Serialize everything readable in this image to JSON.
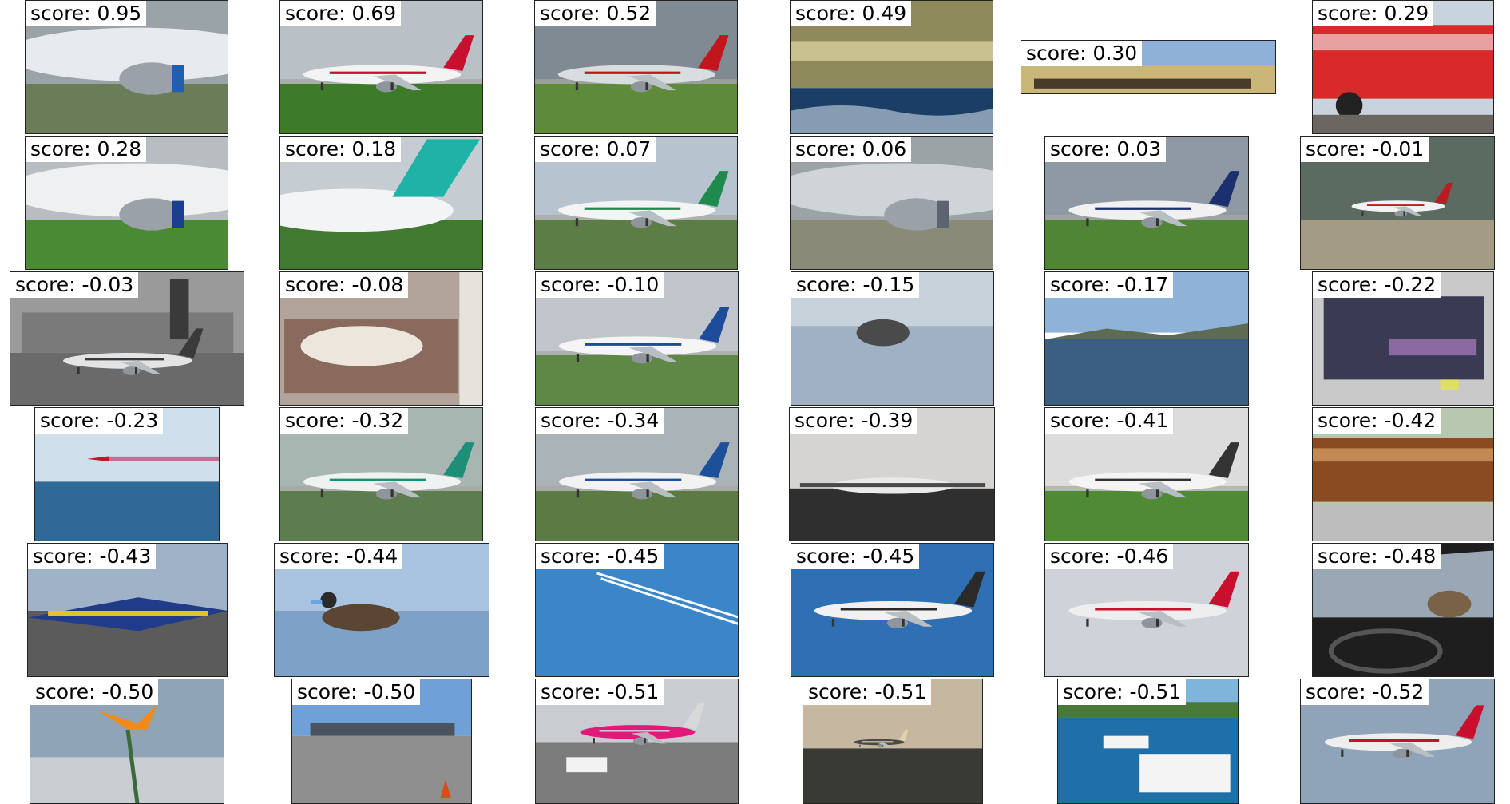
{
  "figure": {
    "tiles": [
      {
        "score": "score: 0.95",
        "scene": "airliner-closeup",
        "colors": {
          "sky": "#9aa3a8",
          "ground": "#6a7d58",
          "body": "#e8ebee",
          "accent": "#1f5fb0"
        }
      },
      {
        "score": "score: 0.69",
        "scene": "airliner",
        "colors": {
          "sky": "#b9c0c6",
          "ground": "#3d7a2a",
          "body": "#f3f3f3",
          "accent": "#c8102e"
        }
      },
      {
        "score": "score: 0.52",
        "scene": "airliner",
        "colors": {
          "sky": "#7f8a93",
          "ground": "#5e8b3a",
          "body": "#d9dde0",
          "accent": "#c0161c"
        }
      },
      {
        "score": "score: 0.49",
        "scene": "seascape",
        "colors": {
          "sky": "#8e8a5c",
          "ground": "#1b3e66",
          "body": "#d8c98a",
          "accent": "#f0e6b0"
        }
      },
      {
        "score": "score: 0.30",
        "scene": "train-landscape",
        "colors": {
          "sky": "#8fb1d8",
          "ground": "#9b8a55",
          "body": "#4a3a2a",
          "accent": "#c9b77a"
        }
      },
      {
        "score": "score: 0.29",
        "scene": "bus",
        "colors": {
          "sky": "#c9d3de",
          "ground": "#6b6660",
          "body": "#d82a2a",
          "accent": "#f2f2f2"
        }
      },
      {
        "score": "score: 0.28",
        "scene": "airliner-closeup",
        "colors": {
          "sky": "#b8bdc1",
          "ground": "#4a8a33",
          "body": "#eef0f2",
          "accent": "#1b3f8f"
        }
      },
      {
        "score": "score: 0.18",
        "scene": "airliner-tail",
        "colors": {
          "sky": "#c6cdd2",
          "ground": "#3f7a2e",
          "body": "#f2f4f5",
          "accent": "#1fb2a6"
        }
      },
      {
        "score": "score: 0.07",
        "scene": "airliner",
        "colors": {
          "sky": "#b7c4cf",
          "ground": "#5d7d47",
          "body": "#f4f4f4",
          "accent": "#1e8a4d"
        }
      },
      {
        "score": "score: 0.06",
        "scene": "airliner-closeup",
        "colors": {
          "sky": "#9ba3a6",
          "ground": "#8a8a78",
          "body": "#cfd4d8",
          "accent": "#5b6470"
        }
      },
      {
        "score": "score: 0.03",
        "scene": "airliner",
        "colors": {
          "sky": "#8e99a3",
          "ground": "#4f8534",
          "body": "#f1f1f1",
          "accent": "#1c2f6e"
        }
      },
      {
        "score": "score: -0.01",
        "scene": "jet-small",
        "colors": {
          "sky": "#5b6b61",
          "ground": "#a49b85",
          "body": "#f2f2f2",
          "accent": "#b81d24"
        }
      },
      {
        "score": "score: -0.03",
        "scene": "old-airport",
        "colors": {
          "sky": "#9a9a9a",
          "ground": "#6a6a6a",
          "body": "#e4e4e4",
          "accent": "#3a3a3a"
        }
      },
      {
        "score": "score: -0.08",
        "scene": "animals-bed",
        "colors": {
          "sky": "#b2a49a",
          "ground": "#8a6a5c",
          "body": "#ece6dc",
          "accent": "#6a4a3a"
        }
      },
      {
        "score": "score: -0.10",
        "scene": "airliner",
        "colors": {
          "sky": "#c0c6cb",
          "ground": "#5f8745",
          "body": "#f5f5f5",
          "accent": "#1e4b9a"
        }
      },
      {
        "score": "score: -0.15",
        "scene": "water-bird",
        "colors": {
          "sky": "#c8d2db",
          "ground": "#9fb1c2",
          "body": "#4a4a4a",
          "accent": "#7d8a95"
        }
      },
      {
        "score": "score: -0.17",
        "scene": "lake",
        "colors": {
          "sky": "#8fb2d8",
          "ground": "#3a5f82",
          "body": "#5d6b52",
          "accent": "#d7e2ec"
        }
      },
      {
        "score": "score: -0.22",
        "scene": "computer-screen",
        "colors": {
          "sky": "#c9c9c9",
          "ground": "#5e7a4a",
          "body": "#3a3a52",
          "accent": "#e0e060"
        }
      },
      {
        "score": "score: -0.23",
        "scene": "sky-jet",
        "colors": {
          "sky": "#cfe0ec",
          "ground": "#2f6a96",
          "body": "#b81d24",
          "accent": "#c74e7c"
        }
      },
      {
        "score": "score: -0.32",
        "scene": "airliner",
        "colors": {
          "sky": "#a8b6b2",
          "ground": "#5e7d4f",
          "body": "#eef2f0",
          "accent": "#1d8f77"
        }
      },
      {
        "score": "score: -0.34",
        "scene": "airliner",
        "colors": {
          "sky": "#a9b3b8",
          "ground": "#5c7a43",
          "body": "#f2f2f2",
          "accent": "#1d4f9a"
        }
      },
      {
        "score": "score: -0.39",
        "scene": "prop-plane",
        "colors": {
          "sky": "#d6d4d2",
          "ground": "#2f2f2f",
          "body": "#eaeaea",
          "accent": "#4a4a4a"
        }
      },
      {
        "score": "score: -0.41",
        "scene": "airliner",
        "colors": {
          "sky": "#dcdcdc",
          "ground": "#4f8a35",
          "body": "#f4f4f4",
          "accent": "#333333"
        }
      },
      {
        "score": "score: -0.42",
        "scene": "train-car",
        "colors": {
          "sky": "#b8c7b0",
          "ground": "#bdbdbd",
          "body": "#8a4a22",
          "accent": "#d9a46a"
        }
      },
      {
        "score": "score: -0.43",
        "scene": "fighter-jet",
        "colors": {
          "sky": "#9fb2c8",
          "ground": "#5b5b5b",
          "body": "#1f3b8a",
          "accent": "#e6c22a"
        }
      },
      {
        "score": "score: -0.44",
        "scene": "duck-water",
        "colors": {
          "sky": "#a9c4e0",
          "ground": "#7ea1c8",
          "body": "#5a4632",
          "accent": "#6aa7e0"
        }
      },
      {
        "score": "score: -0.45",
        "scene": "contrails",
        "colors": {
          "sky": "#3a86c8",
          "ground": "#2f78bd",
          "body": "#f4f8fb",
          "accent": "#ffffff"
        }
      },
      {
        "score": "score: -0.45",
        "scene": "airliner-sky",
        "colors": {
          "sky": "#2f6fb4",
          "ground": "#3478bd",
          "body": "#f1f1f1",
          "accent": "#2a2a2a"
        }
      },
      {
        "score": "score: -0.46",
        "scene": "airliner-sky",
        "colors": {
          "sky": "#cfd3d9",
          "ground": "#d6d9de",
          "body": "#eeeeee",
          "accent": "#c8102e"
        }
      },
      {
        "score": "score: -0.48",
        "scene": "car-interior",
        "colors": {
          "sky": "#9aa7b4",
          "ground": "#1e1e1e",
          "body": "#2a2a2a",
          "accent": "#7a6248"
        }
      },
      {
        "score": "score: -0.50",
        "scene": "flower",
        "colors": {
          "sky": "#8fa4b7",
          "ground": "#c8cdd2",
          "body": "#f08a1a",
          "accent": "#3a6a3a"
        }
      },
      {
        "score": "score: -0.50",
        "scene": "airfield",
        "colors": {
          "sky": "#6fa0d8",
          "ground": "#8f8f8f",
          "body": "#4a5460",
          "accent": "#e04a1a"
        }
      },
      {
        "score": "score: -0.51",
        "scene": "airport-pink",
        "colors": {
          "sky": "#c9ccd0",
          "ground": "#7b7b7b",
          "body": "#e3197a",
          "accent": "#d8d8d8"
        }
      },
      {
        "score": "score: -0.51",
        "scene": "runway-sunset",
        "colors": {
          "sky": "#c6b8a0",
          "ground": "#3a3a34",
          "body": "#4a4a4a",
          "accent": "#e6d2a8"
        }
      },
      {
        "score": "score: -0.51",
        "scene": "harbor",
        "colors": {
          "sky": "#7fb5d8",
          "ground": "#1f6fa8",
          "body": "#f4f4f4",
          "accent": "#4a7a3a"
        }
      },
      {
        "score": "score: -0.52",
        "scene": "airliner-sky",
        "colors": {
          "sky": "#8fa4b8",
          "ground": "#9bb0c2",
          "body": "#eeeeee",
          "accent": "#c8102e"
        }
      }
    ]
  }
}
